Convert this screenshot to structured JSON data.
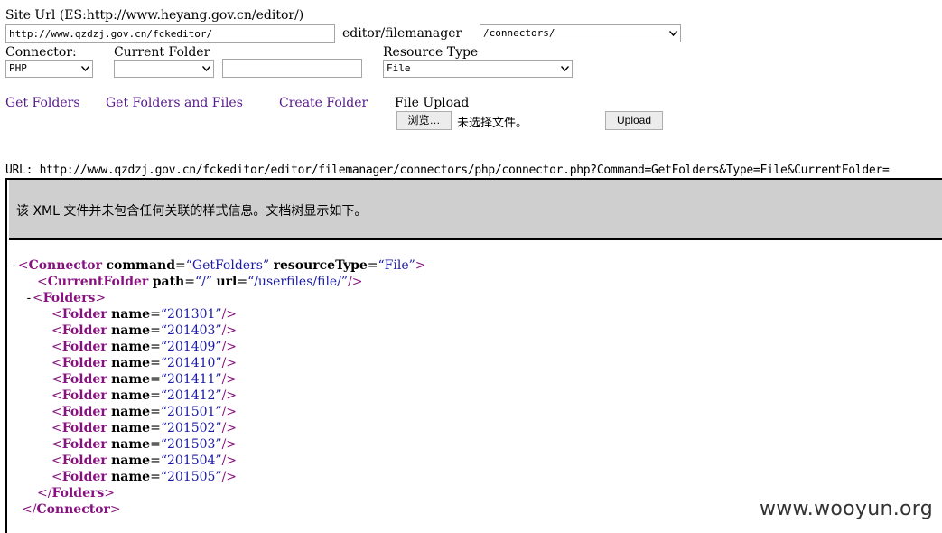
{
  "form": {
    "site_url_label": "Site Url (ES:http://www.heyang.gov.cn/editor/)",
    "site_url_value": "http://www.qzdzj.gov.cn/fckeditor/",
    "path_label": "editor/filemanager",
    "connectors_select": "/connectors/",
    "connector_label": "Connector:",
    "connector_select": "PHP",
    "current_folder_label": "Current Folder",
    "current_folder_select": "",
    "current_folder_value": "",
    "resource_type_label": "Resource Type",
    "resource_type_select": "File",
    "get_folders": "Get Folders",
    "get_folders_files": "Get Folders and Files",
    "create_folder": "Create Folder",
    "file_upload_label": "File Upload",
    "browse_button": "浏览…",
    "no_file_text": "未选择文件。",
    "upload_button": "Upload"
  },
  "url_line": "URL: http://www.qzdzj.gov.cn/fckeditor/editor/filemanager/connectors/php/connector.php?Command=GetFolders&Type=File&CurrentFolder=",
  "notice": "该 XML 文件并未包含任何关联的样式信息。文档树显示如下。",
  "xml": {
    "root_tag": "Connector",
    "root_attrs": [
      {
        "name": "command",
        "value": "GetFolders"
      },
      {
        "name": "resourceType",
        "value": "File"
      }
    ],
    "current_folder_tag": "CurrentFolder",
    "current_folder_attrs": [
      {
        "name": "path",
        "value": "/"
      },
      {
        "name": "url",
        "value": "/userfiles/file/"
      }
    ],
    "folders_tag": "Folders",
    "folder_tag": "Folder",
    "folder_attr": "name",
    "folders": [
      "201301",
      "201403",
      "201409",
      "201410",
      "201411",
      "201412",
      "201501",
      "201502",
      "201503",
      "201504",
      "201505"
    ]
  },
  "watermark": "www.wooyun.org",
  "colors": {
    "tag": "#881280",
    "value": "#1a1aa6",
    "link": "#551a8b",
    "notice_bg": "#cfcfcf"
  }
}
